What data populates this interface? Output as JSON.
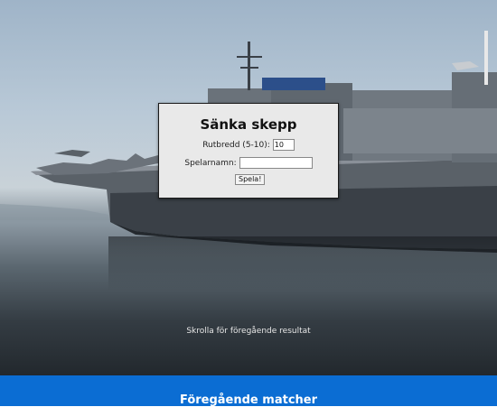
{
  "game": {
    "title": "Sänka skepp",
    "width_label": "Rutbredd (5-10):",
    "width_value": "10",
    "name_label": "Spelarnamn:",
    "name_value": "",
    "play_label": "Spela!"
  },
  "hero": {
    "scroll_hint": "Skrolla för föregående resultat"
  },
  "footer": {
    "title": "Föregående matcher"
  },
  "colors": {
    "footer_bg": "#0b6dd3",
    "dialog_bg": "#e9e9e9"
  }
}
